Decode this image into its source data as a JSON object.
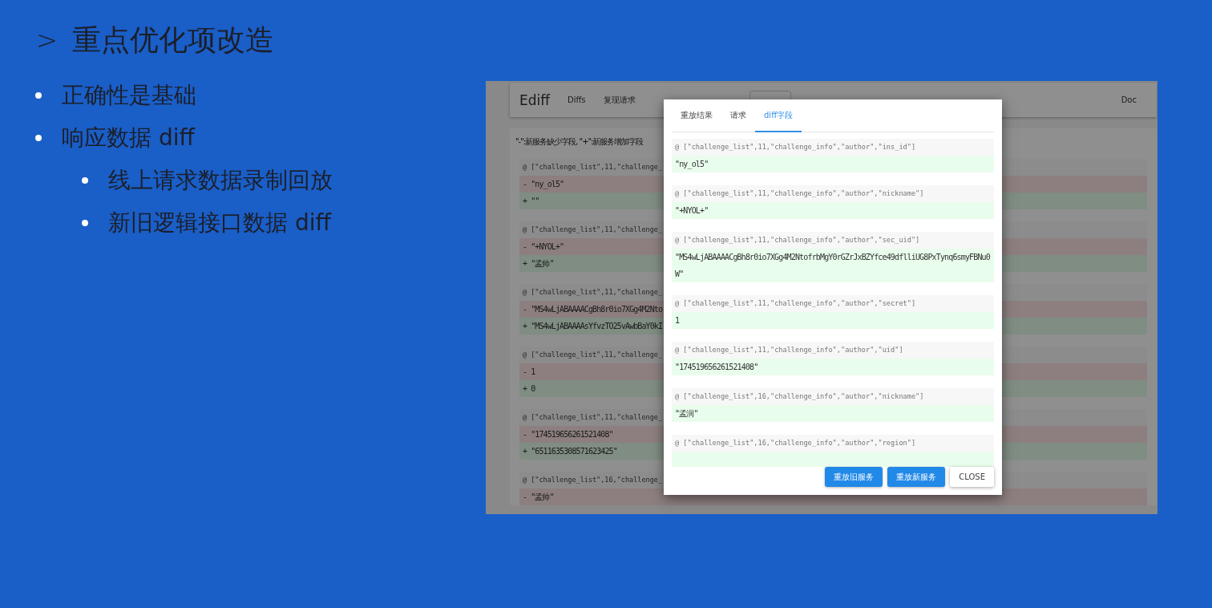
{
  "slide": {
    "title_marker": ">",
    "title": "重点优化项改造",
    "bullets": [
      {
        "text": "正确性是基础"
      },
      {
        "text": "响应数据 diff",
        "children": [
          {
            "text": "线上请求数据录制回放"
          },
          {
            "text": "新旧逻辑接口数据 diff"
          }
        ]
      }
    ]
  },
  "app": {
    "logo": "Ediff",
    "nav": [
      {
        "label": "Diffs"
      },
      {
        "label": "复现请求"
      }
    ],
    "doc_link": "Doc",
    "legend": "\"-\":新服务缺少字段, \"+\":新服务增加字段",
    "diff_groups": [
      {
        "path": "@ [\"challenge_list\",11,\"challenge_",
        "lines": [
          {
            "kind": "removed",
            "text": "- \"ny_ol5\""
          },
          {
            "kind": "added",
            "text": "+ \"\""
          }
        ]
      },
      {
        "path": "@ [\"challenge_list\",11,\"challenge_",
        "lines": [
          {
            "kind": "removed",
            "text": "- \"+NYOL+\""
          },
          {
            "kind": "added",
            "text": "+ \"孟帅\""
          }
        ]
      },
      {
        "path": "@ [\"challenge_list\",11,\"challenge_",
        "lines": [
          {
            "kind": "removed",
            "text": "- \"MS4wLjABAAAACgBh8r0io7XGg4M2Nto"
          },
          {
            "kind": "added",
            "text": "+ \"MS4wLjABAAAAsYfvzTO25vAwbBaY0kI"
          }
        ]
      },
      {
        "path": "@ [\"challenge_list\",11,\"challenge_",
        "lines": [
          {
            "kind": "removed",
            "text": "- 1"
          },
          {
            "kind": "added",
            "text": "+ 0"
          }
        ]
      },
      {
        "path": "@ [\"challenge_list\",11,\"challenge_",
        "lines": [
          {
            "kind": "removed",
            "text": "- \"174519656261521408\""
          },
          {
            "kind": "added",
            "text": "+ \"6511635308571623425\""
          }
        ]
      },
      {
        "path": "@ [\"challenge_list\",16,\"challenge_",
        "lines": [
          {
            "kind": "removed",
            "text": "- \"孟帅\""
          }
        ]
      }
    ]
  },
  "dialog": {
    "tabs": [
      {
        "label": "重放结果",
        "selected": false
      },
      {
        "label": "请求",
        "selected": false
      },
      {
        "label": "diff字段",
        "selected": true
      }
    ],
    "fields": [
      {
        "path": "@ [\"challenge_list\",11,\"challenge_info\",\"author\",\"ins_id\"]",
        "value": "\"ny_ol5\""
      },
      {
        "path": "@ [\"challenge_list\",11,\"challenge_info\",\"author\",\"nickname\"]",
        "value": "\"+NYOL+\""
      },
      {
        "path": "@ [\"challenge_list\",11,\"challenge_info\",\"author\",\"sec_uid\"]",
        "value": "\"MS4wLjABAAAACgBh8r0io7XGg4M2NtofrbMgY0rGZrJxBZYfce49dflliUG8PxTynq6smyFBNu0W\""
      },
      {
        "path": "@ [\"challenge_list\",11,\"challenge_info\",\"author\",\"secret\"]",
        "value": "1"
      },
      {
        "path": "@ [\"challenge_list\",11,\"challenge_info\",\"author\",\"uid\"]",
        "value": "\"174519656261521408\""
      },
      {
        "path": "@ [\"challenge_list\",16,\"challenge_info\",\"author\",\"nickname\"]",
        "value": "\"孟润\""
      },
      {
        "path": "@ [\"challenge_list\",16,\"challenge_info\",\"author\",\"region\"]"
      }
    ],
    "buttons": [
      {
        "label": "重放旧服务",
        "kind": "primary"
      },
      {
        "label": "重放新服务",
        "kind": "primary"
      },
      {
        "label": "CLOSE",
        "kind": "plain"
      }
    ]
  }
}
